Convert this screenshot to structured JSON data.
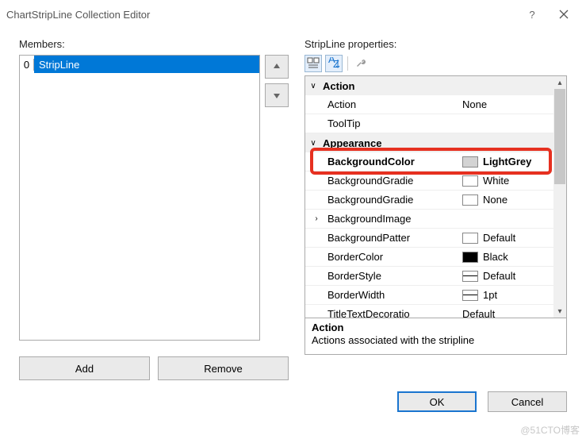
{
  "title": "ChartStripLine Collection Editor",
  "labels": {
    "members": "Members:",
    "properties": "StripLine properties:",
    "add": "Add",
    "remove": "Remove",
    "ok": "OK",
    "cancel": "Cancel"
  },
  "members": [
    {
      "index": "0",
      "name": "StripLine"
    }
  ],
  "categories": [
    {
      "name": "Action",
      "expanded": true,
      "expander": "∨",
      "props": [
        {
          "name": "Action",
          "value": "None"
        },
        {
          "name": "ToolTip",
          "value": ""
        }
      ]
    },
    {
      "name": "Appearance",
      "expanded": true,
      "expander": "∨",
      "props": [
        {
          "name": "BackgroundColor",
          "value": "LightGrey",
          "swatch": "#d3d3d3",
          "highlight": true,
          "bold": true
        },
        {
          "name": "BackgroundGradientEndColor",
          "display": "BackgroundGradie",
          "value": "White",
          "swatch": "#ffffff"
        },
        {
          "name": "BackgroundGradientType",
          "display": "BackgroundGradie",
          "value": "None",
          "swatch": "#ffffff"
        },
        {
          "name": "BackgroundImage",
          "display": "BackgroundImage",
          "value": "",
          "expander": "›"
        },
        {
          "name": "BackgroundHatchType",
          "display": "BackgroundPatter",
          "value": "Default",
          "swatch": "#ffffff"
        },
        {
          "name": "BorderColor",
          "value": "Black",
          "swatch": "#000000"
        },
        {
          "name": "BorderStyle",
          "value": "Default",
          "swatch": "line"
        },
        {
          "name": "BorderWidth",
          "value": "1pt",
          "swatch": "line"
        },
        {
          "name": "TitleTextDecoration",
          "display": "TitleTextDecoratio",
          "value": "Default"
        }
      ]
    }
  ],
  "help": {
    "title": "Action",
    "desc": "Actions associated with the stripline"
  },
  "watermark": "@51CTO博客"
}
